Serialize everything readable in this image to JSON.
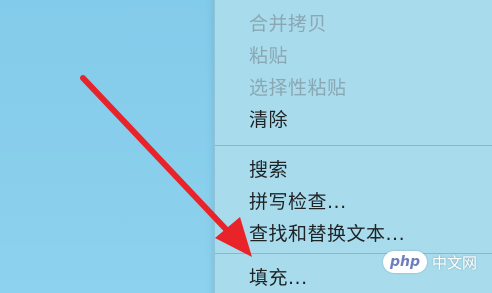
{
  "context_menu": {
    "items_top": [
      {
        "label": "合并拷贝",
        "enabled": false
      },
      {
        "label": "粘贴",
        "enabled": false
      },
      {
        "label": "选择性粘贴",
        "enabled": false
      },
      {
        "label": "清除",
        "enabled": true
      }
    ],
    "items_middle": [
      {
        "label": "搜索",
        "enabled": true
      },
      {
        "label": "拼写检查...",
        "enabled": true
      },
      {
        "label": "查找和替换文本...",
        "enabled": true
      }
    ],
    "items_bottom": [
      {
        "label": "填充...",
        "enabled": true
      }
    ]
  },
  "annotation": {
    "arrow_color": "#e8232a",
    "points_to": "填充..."
  },
  "watermark": {
    "logo": "php",
    "text": "中文网"
  },
  "colors": {
    "background": "#86cdea",
    "menu_background": "#a8dced",
    "enabled_text": "#1f2326",
    "disabled_text": "#8aa7b3"
  }
}
